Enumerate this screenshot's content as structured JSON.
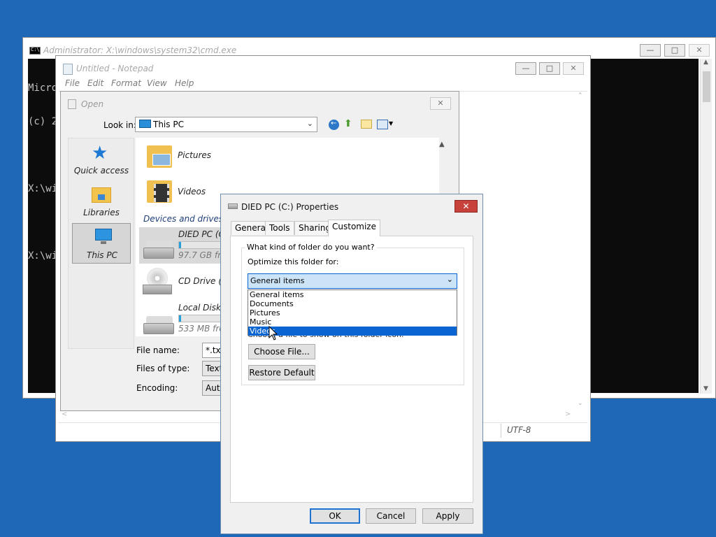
{
  "colors": {
    "desktop": "#1f68b8",
    "selection": "#0a64d2",
    "close_red": "#c8423c"
  },
  "cmd": {
    "title": "Administrator: X:\\windows\\system32\\cmd.exe",
    "lines": [
      "Micro",
      "(c) 2",
      "",
      "X:\\wi",
      "",
      "X:\\wi"
    ]
  },
  "notepad": {
    "title": "Untitled - Notepad",
    "menu": [
      "File",
      "Edit",
      "Format",
      "View",
      "Help"
    ],
    "status_encoding": "UTF-8"
  },
  "open_dialog": {
    "title": "Open",
    "look_in_label": "Look in:",
    "look_in_value": "This PC",
    "places": [
      "Quick access",
      "Libraries",
      "This PC"
    ],
    "folders": [
      "Pictures",
      "Videos"
    ],
    "group_header": "Devices and drives (4",
    "drives": [
      {
        "name": "DIED PC (C:",
        "free": "97.7 GB free",
        "usage": 0.03
      },
      {
        "name": "CD Drive (D"
      },
      {
        "name": "Local Disk (",
        "free": "533 MB free",
        "usage": 0.03
      }
    ],
    "file_name_label": "File name:",
    "file_name_value": "*.txt",
    "files_of_type_label": "Files of type:",
    "files_of_type_value": "Text",
    "encoding_label": "Encoding:",
    "encoding_value": "Auto"
  },
  "properties": {
    "title": "DIED PC (C:) Properties",
    "tabs": [
      "General",
      "Tools",
      "Sharing",
      "Customize"
    ],
    "group_title": "What kind of folder do you want?",
    "optimize_label": "Optimize this folder for:",
    "selected": "General items",
    "options": [
      "General items",
      "Documents",
      "Pictures",
      "Music",
      "Videos"
    ],
    "choose_hint": "Choose a file to show on this folder icon.",
    "choose_file": "Choose File...",
    "restore_default": "Restore Default",
    "ok": "OK",
    "cancel": "Cancel",
    "apply": "Apply"
  }
}
